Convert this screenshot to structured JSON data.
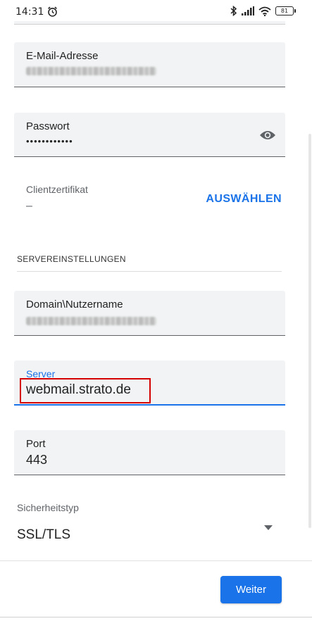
{
  "status_bar": {
    "time": "14:31",
    "battery": "81",
    "icons": [
      "alarm-icon",
      "bluetooth-icon",
      "signal-icon",
      "wifi-icon",
      "battery-icon"
    ]
  },
  "form": {
    "email": {
      "label": "E-Mail-Adresse"
    },
    "password": {
      "label": "Passwort",
      "masked_value": "••••••••••••"
    },
    "client_certificate": {
      "label": "Clientzertifikat",
      "value": "–",
      "action_label": "AUSWÄHLEN"
    },
    "server_section": {
      "title": "SERVEREINSTELLUNGEN",
      "domain": {
        "label": "Domain\\Nutzername"
      },
      "server": {
        "label": "Server",
        "value": "webmail.strato.de"
      },
      "port": {
        "label": "Port",
        "value": "443"
      },
      "security": {
        "label": "Sicherheitstyp",
        "value": "SSL/TLS"
      }
    }
  },
  "footer": {
    "next_label": "Weiter"
  },
  "colors": {
    "accent": "#1a73e8",
    "highlight": "#d50000",
    "field_bg": "#f1f3f4"
  }
}
